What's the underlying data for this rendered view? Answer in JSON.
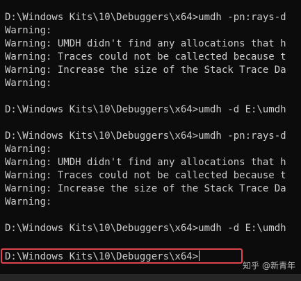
{
  "console": {
    "lines": [
      "D:\\Windows Kits\\10\\Debuggers\\x64>umdh -pn:rays-d",
      "Warning:",
      "Warning: UMDH didn't find any allocations that h",
      "Warning: Traces could not be callected because t",
      "Warning: Increase the size of the Stack Trace Da",
      "Warning:",
      "",
      "D:\\Windows Kits\\10\\Debuggers\\x64>umdh -d E:\\umdh",
      "",
      "D:\\Windows Kits\\10\\Debuggers\\x64>umdh -pn:rays-d",
      "Warning:",
      "Warning: UMDH didn't find any allocations that h",
      "Warning: Traces could not be callected because t",
      "Warning: Increase the size of the Stack Trace Da",
      "Warning:",
      "",
      "D:\\Windows Kits\\10\\Debuggers\\x64>umdh -d E:\\umdh"
    ],
    "prompt": "D:\\Windows Kits\\10\\Debuggers\\x64>"
  },
  "watermark": {
    "text": "知乎 @新青年"
  },
  "colors": {
    "background": "#0c0c0c",
    "text": "#cccccc",
    "highlight_border": "#e0454d"
  }
}
